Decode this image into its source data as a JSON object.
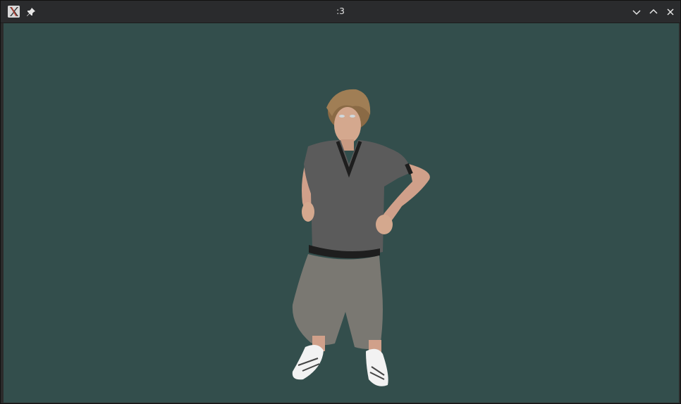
{
  "window": {
    "title": ":3",
    "background_color": "#334e4c",
    "icons": {
      "app": "xorg-x-icon",
      "pin": "pin-icon",
      "minimize": "chevron-down-icon",
      "maximize": "chevron-up-icon",
      "close": "close-icon"
    }
  },
  "viewport": {
    "content": "3d-avatar-render"
  }
}
